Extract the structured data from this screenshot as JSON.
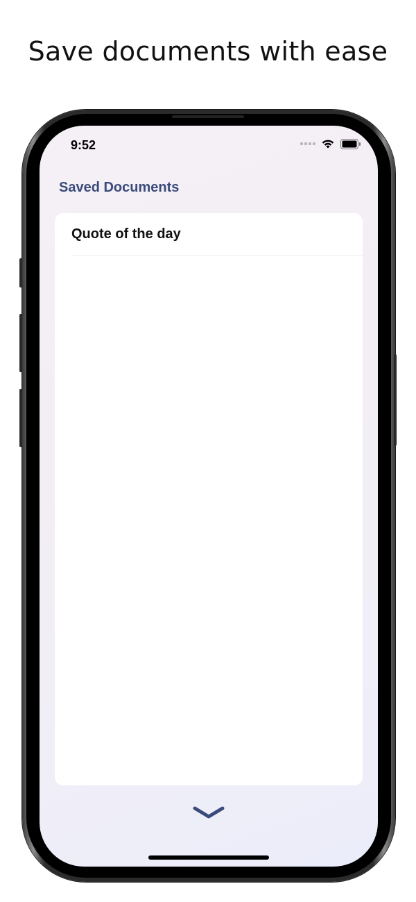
{
  "headline": "Save documents with ease",
  "status_bar": {
    "time": "9:52",
    "icons": [
      "signal-icon",
      "wifi-icon",
      "battery-icon"
    ]
  },
  "nav": {
    "title": "Saved Documents"
  },
  "documents": [
    {
      "title": "Quote of the day"
    }
  ],
  "footer": {
    "icon": "chevron-down-icon"
  },
  "colors": {
    "accent": "#3a4a7a",
    "background": "#f3eef5",
    "card": "#ffffff"
  }
}
